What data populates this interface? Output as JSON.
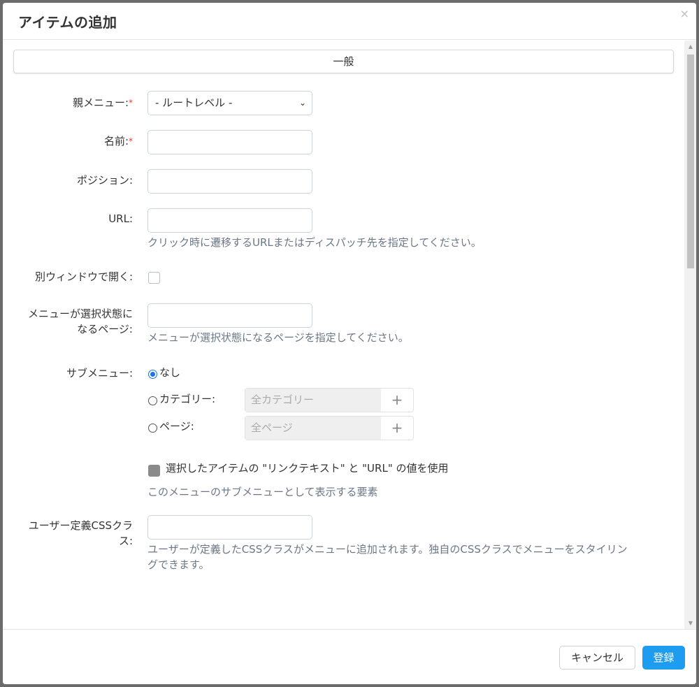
{
  "dialog": {
    "title": "アイテムの追加",
    "close_icon": "×"
  },
  "section": {
    "label": "一般"
  },
  "form": {
    "parent_menu": {
      "label": "親メニュー:",
      "required_mark": "*",
      "value": "- ルートレベル -"
    },
    "name": {
      "label": "名前:",
      "required_mark": "*",
      "value": ""
    },
    "position": {
      "label": "ポジション:",
      "value": ""
    },
    "url": {
      "label": "URL:",
      "value": "",
      "help": "クリック時に遷移するURLまたはディスパッチ先を指定してください。"
    },
    "open_new_window": {
      "label": "別ウィンドウで開く:",
      "checked": false
    },
    "selected_page": {
      "label_line1": "メニューが選択状態に",
      "label_line2": "なるページ:",
      "value": "",
      "help": "メニューが選択状態になるページを指定してください。"
    },
    "submenu": {
      "label": "サブメニュー:",
      "options": [
        {
          "label": "なし",
          "selected": true
        },
        {
          "label": "カテゴリー:",
          "selected": false,
          "picker_placeholder": "全カテゴリー",
          "add": "+"
        },
        {
          "label": "ページ:",
          "selected": false,
          "picker_placeholder": "全ページ",
          "add": "+"
        }
      ],
      "use_values_label": "選択したアイテムの \"リンクテキスト\" と \"URL\" の値を使用",
      "help": "このメニューのサブメニューとして表示する要素"
    },
    "custom_css": {
      "label_line1": "ユーザー定義CSSクラ",
      "label_line2": "ス:",
      "value": "",
      "help_line1": "ユーザーが定義したCSSクラスがメニューに追加されます。独自のCSSクラスでメニューをスタイリン",
      "help_line2": "グできます。"
    }
  },
  "footer": {
    "cancel_label": "キャンセル",
    "save_label": "登録"
  },
  "colors": {
    "primary": "#1e9cf0",
    "required": "#e53935",
    "radio_selected": "#1a73e8"
  }
}
